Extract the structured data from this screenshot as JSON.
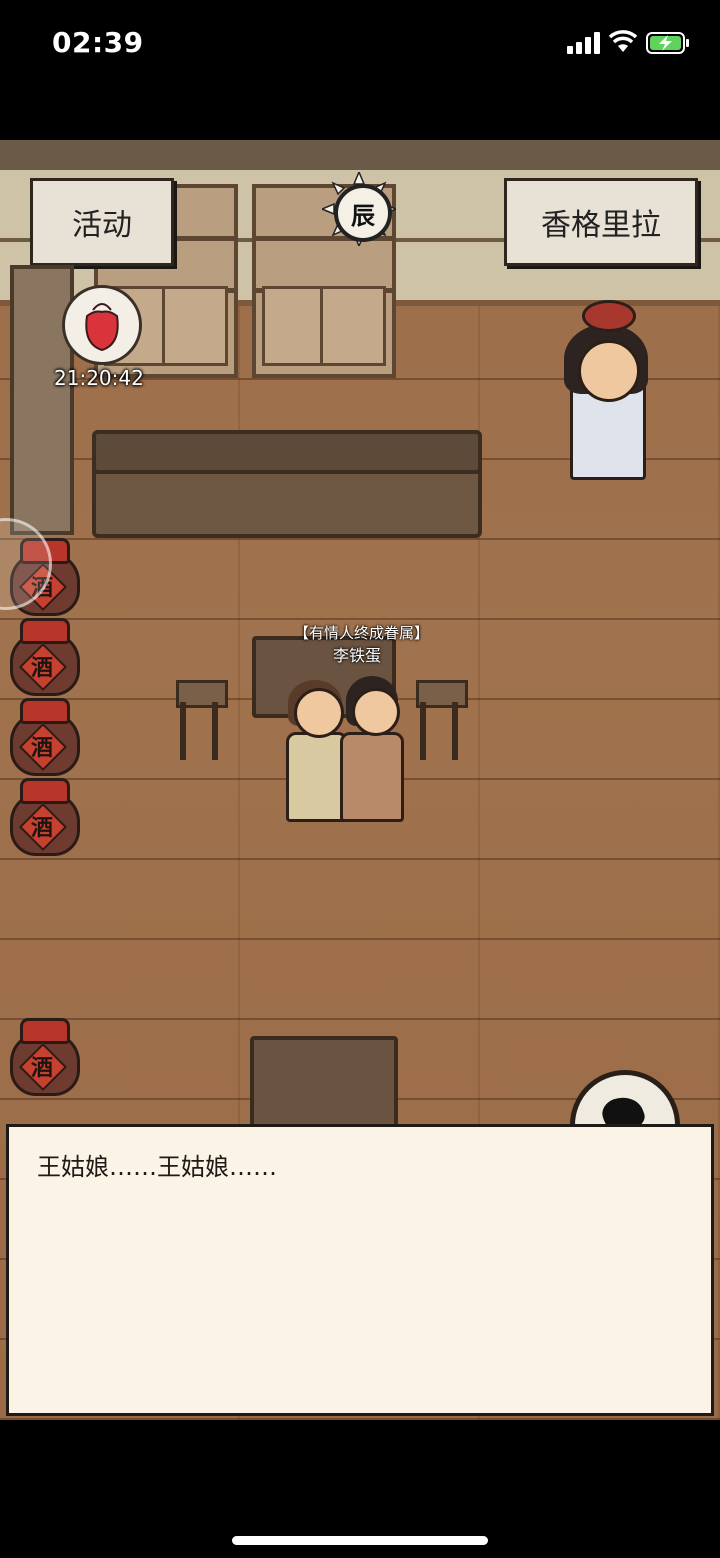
{
  "status_bar": {
    "time": "02:39",
    "signal_icon": "cellular-signal-icon",
    "wifi_icon": "wifi-icon",
    "battery_icon": "battery-charging-icon",
    "battery_color": "#5fd35b"
  },
  "scene": {
    "activity_button": "活动",
    "location_button": "香格里拉",
    "time_of_day_badge": "辰",
    "event_timer": "21:20:42",
    "player": {
      "title": "【有情人终成眷属】",
      "name": "李铁蛋"
    },
    "jar_label": "酒",
    "run_button_icon": "running-man-icon"
  },
  "dialog": {
    "text": "王姑娘……王姑娘……"
  }
}
